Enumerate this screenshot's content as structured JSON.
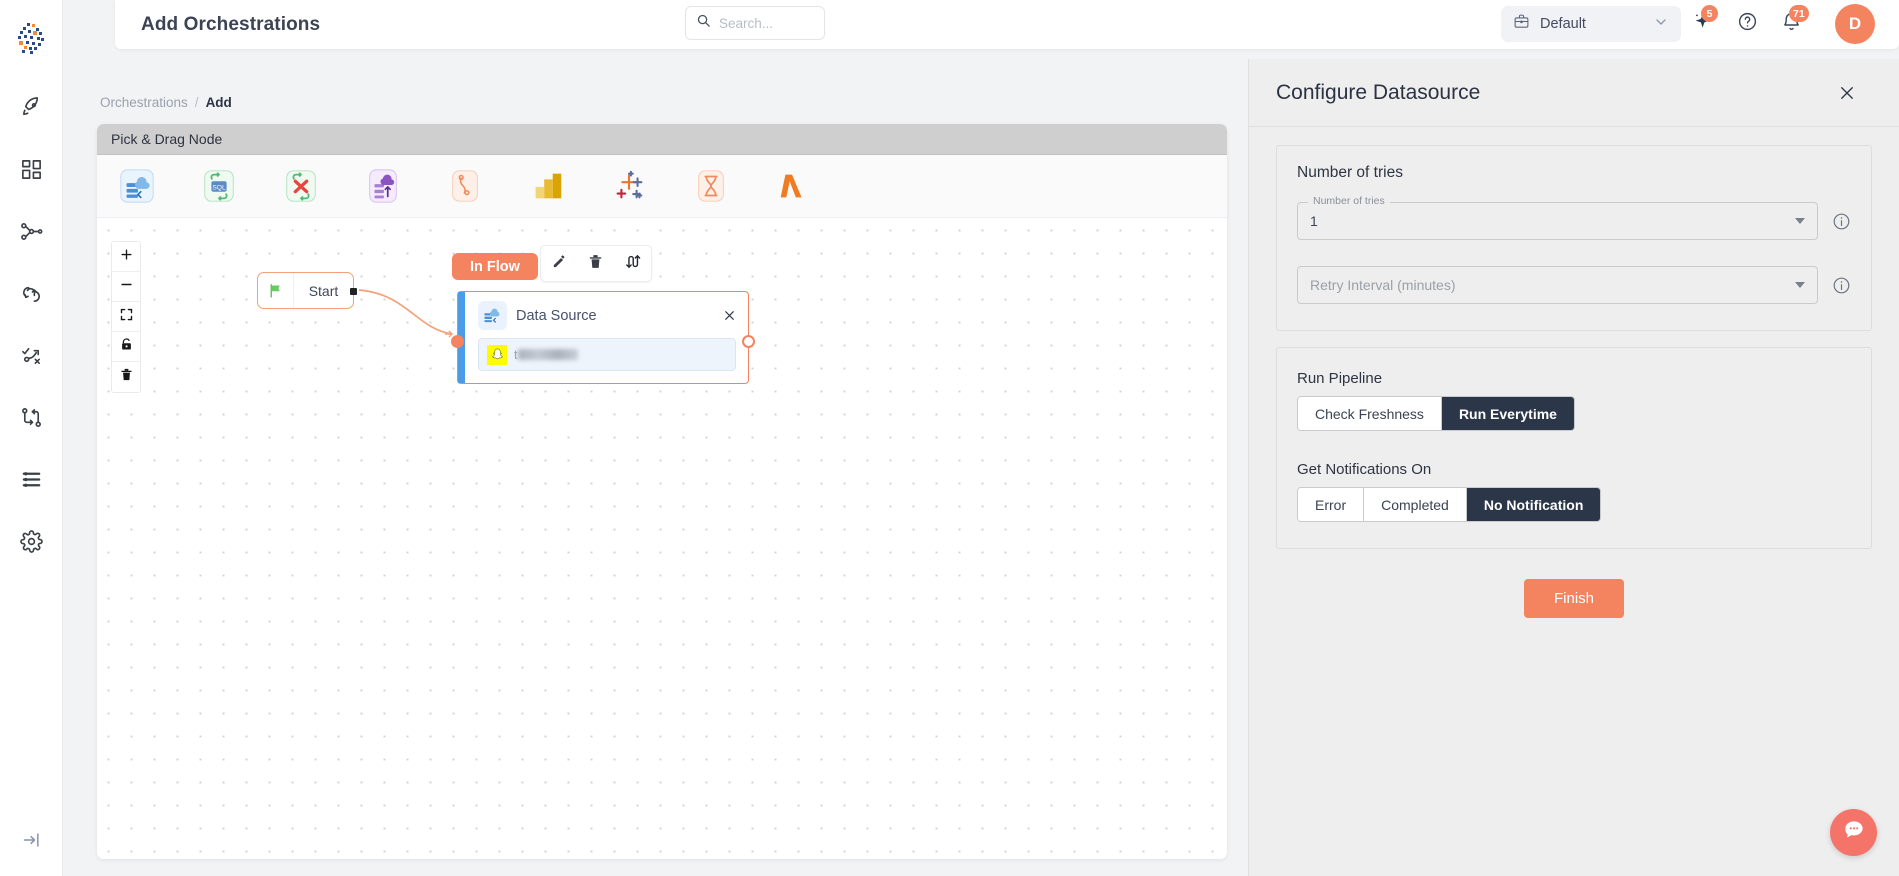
{
  "app": {
    "logo_name": "mosaic-logo",
    "accent": "#f4845f",
    "dark": "#2b3649",
    "node_blue": "#4a9ce8"
  },
  "sidebar": {
    "expand_label": "expand-sidebar",
    "items": [
      {
        "icon": "rocket-icon",
        "name": "sidebar-item-launch"
      },
      {
        "icon": "grid-icon",
        "name": "sidebar-item-dashboard"
      },
      {
        "icon": "hierarchy-icon",
        "name": "sidebar-item-pipelines"
      },
      {
        "icon": "cloud-sync-icon",
        "name": "sidebar-item-sync"
      },
      {
        "icon": "route-icon",
        "name": "sidebar-item-orchestrations"
      },
      {
        "icon": "branch-icon",
        "name": "sidebar-item-workflows"
      },
      {
        "icon": "list-icon",
        "name": "sidebar-item-logs"
      },
      {
        "icon": "gear-icon",
        "name": "sidebar-item-settings"
      }
    ]
  },
  "topbar": {
    "title": "Add Orchestrations",
    "search": {
      "placeholder": "Search...",
      "value": ""
    },
    "workspace": {
      "label": "Default",
      "icon": "briefcase-icon",
      "caret": "chevron-down-icon"
    },
    "ai_icon": "sparkle-icon",
    "ai_badge": "5",
    "help_icon": "question-circle-icon",
    "bell_icon": "bell-icon",
    "bell_badge": "71",
    "avatar_initial": "D"
  },
  "breadcrumb": {
    "parent": "Orchestrations",
    "separator": "/",
    "current": "Add"
  },
  "palette": {
    "header": "Pick & Drag Node",
    "items": [
      {
        "name": "palette-data-source",
        "icon": "cloud-database-icon"
      },
      {
        "name": "palette-sql-sync",
        "icon": "sql-sync-icon"
      },
      {
        "name": "palette-transform",
        "icon": "transform-x-icon"
      },
      {
        "name": "palette-data-load",
        "icon": "data-upload-icon"
      },
      {
        "name": "palette-snowflake",
        "icon": "snowflake-icon"
      },
      {
        "name": "palette-power-bi",
        "icon": "power-bi-icon"
      },
      {
        "name": "palette-tableau",
        "icon": "tableau-icon"
      },
      {
        "name": "palette-scheduler",
        "icon": "hourglass-icon"
      },
      {
        "name": "palette-lambda",
        "icon": "lambda-icon"
      }
    ]
  },
  "canvas": {
    "zoom_controls": [
      {
        "name": "zoom-in-button",
        "icon": "plus-icon"
      },
      {
        "name": "zoom-out-button",
        "icon": "minus-icon"
      },
      {
        "name": "fit-view-button",
        "icon": "fit-screen-icon"
      },
      {
        "name": "lock-button",
        "icon": "lock-icon"
      },
      {
        "name": "clear-button",
        "icon": "trash-icon"
      }
    ],
    "start_node": {
      "label": "Start",
      "icon": "green-flag-icon"
    },
    "flow_badge": "In Flow",
    "node_toolbar": [
      {
        "name": "edit-node-button",
        "icon": "pencil-icon"
      },
      {
        "name": "delete-node-button",
        "icon": "trash-icon"
      },
      {
        "name": "swap-node-button",
        "icon": "swap-arrows-icon"
      }
    ],
    "data_source_node": {
      "title": "Data Source",
      "icon": "cloud-database-icon",
      "close_icon": "close-icon",
      "field": {
        "icon": "snapchat-icon",
        "value": "t",
        "masked": true
      }
    }
  },
  "panel": {
    "title": "Configure Datasource",
    "close_icon": "close-icon",
    "tries_section_title": "Number of tries",
    "tries_field": {
      "label": "Number of tries",
      "value": "1",
      "info_icon": "info-icon"
    },
    "retry_field": {
      "placeholder": "Retry Interval (minutes)",
      "value": "",
      "info_icon": "info-icon"
    },
    "run_pipeline": {
      "label": "Run Pipeline",
      "options": [
        "Check Freshness",
        "Run Everytime"
      ],
      "selected": "Run Everytime"
    },
    "notifications": {
      "label": "Get Notifications On",
      "options": [
        "Error",
        "Completed",
        "No Notification"
      ],
      "selected": "No Notification"
    },
    "finish_label": "Finish"
  },
  "chat": {
    "icon": "chat-bubble-icon"
  }
}
